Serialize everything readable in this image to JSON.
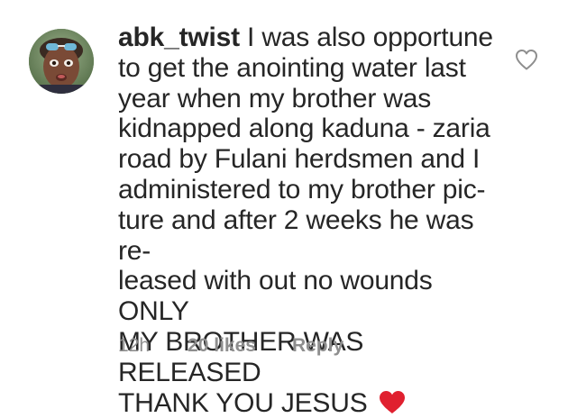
{
  "comment": {
    "username": "abk_twist",
    "text_lines": [
      " I was also opportune",
      "to get the anointing water last",
      "year when my brother was",
      "kidnapped along kaduna - zaria",
      "road by Fulani herdsmen and I",
      "administered to my brother pic-",
      "ture and after 2 weeks he was re-",
      "leased with out no wounds ONLY",
      "MY BROTHER WAS RELEASED",
      "THANK YOU JESUS"
    ],
    "emoji": "red-heart-emoji",
    "time": "12h",
    "likes": "20 likes",
    "reply_label": "Reply",
    "like_icon": "heart-outline-icon"
  },
  "colors": {
    "text": "#262626",
    "meta": "#8e8e8e",
    "heart_emoji": "#e0202f",
    "like_icon_stroke": "#8e8e8e"
  }
}
